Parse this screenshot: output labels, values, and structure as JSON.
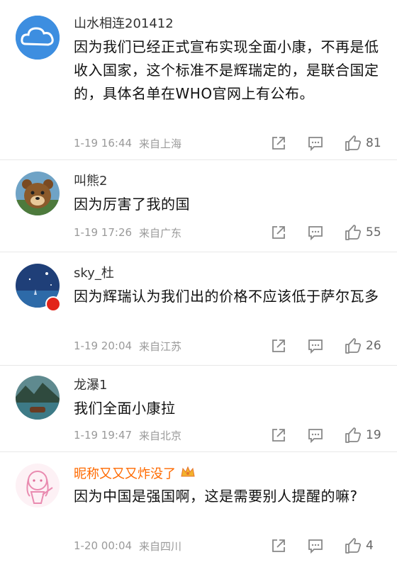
{
  "comments": [
    {
      "username": "山水相连201412",
      "text": "因为我们已经正式宣布实现全面小康，不再是低收入国家，这个标准不是辉瑞定的，是联合国定的，具体名单在WHO官网上有公布。",
      "date": "1-19 16:44",
      "location": "来自上海",
      "likes": "81",
      "avatar_icon": "cloud-avatar-icon"
    },
    {
      "username": "叫熊2",
      "text": "因为厉害了我的国",
      "date": "1-19 17:26",
      "location": "来自广东",
      "likes": "55",
      "avatar_icon": "bear-avatar-icon"
    },
    {
      "username": "sky_杜",
      "text": "因为辉瑞认为我们出的价格不应该低于萨尔瓦多",
      "date": "1-19 20:04",
      "location": "来自江苏",
      "likes": "26",
      "avatar_icon": "night-sky-avatar-icon"
    },
    {
      "username": "龙瀑1",
      "text": "我们全面小康拉",
      "date": "1-19 19:47",
      "location": "来自北京",
      "likes": "19",
      "avatar_icon": "lake-avatar-icon"
    },
    {
      "username": "昵称又又又炸没了",
      "text": "因为中国是强国啊，这是需要别人提醒的嘛?",
      "date": "1-20 00:04",
      "location": "来自四川",
      "likes": "4",
      "avatar_icon": "cartoon-girl-avatar-icon"
    }
  ],
  "colors": {
    "vip_name": "#ff6a00",
    "meta_text": "#9a9a9a",
    "region_badge": "#e2241a"
  }
}
